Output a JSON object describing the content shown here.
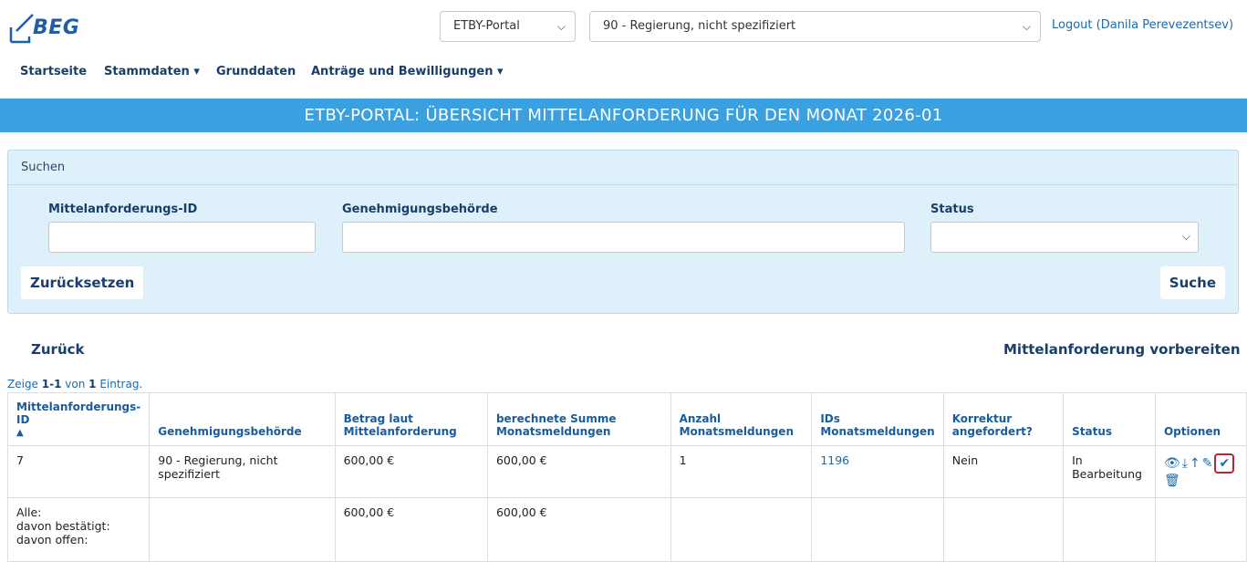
{
  "header": {
    "logo_text": "BEG",
    "portal_select": "ETBY-Portal",
    "authority_select": "90 - Regierung, nicht spezifiziert",
    "logout": "Logout (Danila Perevezentsev)"
  },
  "nav": {
    "home": "Startseite",
    "master_data": "Stammdaten ▾",
    "base_data": "Grunddaten",
    "applications": "Anträge und Bewilligungen ▾"
  },
  "banner": "ETBY-PORTAL: ÜBERSICHT MITTELANFORDERUNG FÜR DEN MONAT 2026-01",
  "search": {
    "title": "Suchen",
    "id_label": "Mittelanforderungs-ID",
    "authority_label": "Genehmigungsbehörde",
    "status_label": "Status",
    "id_value": "",
    "authority_value": "",
    "status_value": "",
    "reset": "Zurücksetzen",
    "submit": "Suche"
  },
  "actions": {
    "back": "Zurück",
    "prepare": "Mittelanforderung vorbereiten"
  },
  "summary": {
    "prefix": "Zeige ",
    "range": "1-1",
    "mid": " von ",
    "total": "1",
    "suffix": " Eintrag."
  },
  "table": {
    "headers": {
      "id": "Mittelanforderungs-ID",
      "authority": "Genehmigungsbehörde",
      "amount": "Betrag laut Mittelanforderung",
      "sum": "berechnete Summe Monatsmeldungen",
      "count": "Anzahl Monatsmeldungen",
      "ids": "IDs Monatsmeldungen",
      "correction": "Korrektur angefordert?",
      "status": "Status",
      "options": "Optionen"
    },
    "row": {
      "id": "7",
      "authority": "90 - Regierung, nicht spezifiziert",
      "amount": "600,00 €",
      "sum": "600,00 €",
      "count": "1",
      "ids": "1196",
      "correction": "Nein",
      "status": "In Bearbeitung"
    },
    "totals": {
      "label_all": "Alle:",
      "label_confirmed": "davon bestätigt:",
      "label_open": "davon offen:",
      "amount": "600,00 €",
      "sum": "600,00 €"
    },
    "option_icons": [
      "eye-icon",
      "download-icon",
      "upload-icon",
      "edit-icon",
      "check-icon",
      "trash-icon"
    ]
  },
  "colors": {
    "banner": "#3aa0e0",
    "link": "#1e6aa8",
    "highlight": "#c0242e"
  }
}
